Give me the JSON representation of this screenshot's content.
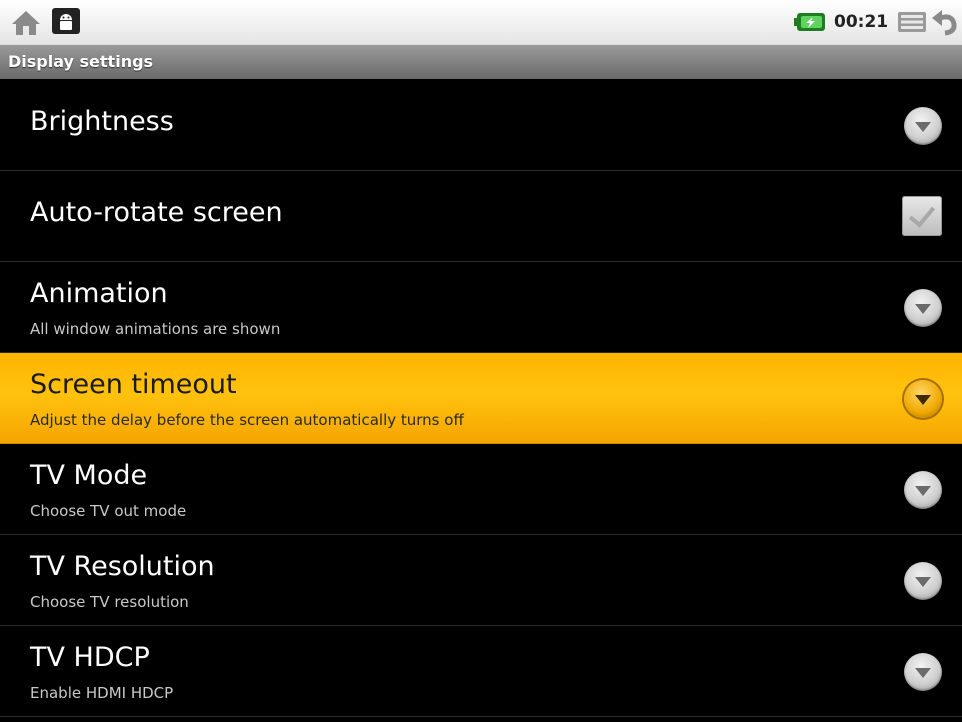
{
  "status_bar": {
    "icons": {
      "left": [
        "home-icon",
        "android-debug-icon"
      ],
      "right": [
        "battery-charging-icon",
        "menu-icon",
        "back-icon"
      ]
    },
    "time": "00:21"
  },
  "title_bar": {
    "title": "Display settings"
  },
  "colors": {
    "highlight": "#ffb400",
    "background": "#000000",
    "title_bar": "#808080"
  },
  "settings": [
    {
      "title": "Brightness",
      "summary": "",
      "control": "dropdown"
    },
    {
      "title": "Auto-rotate screen",
      "summary": "",
      "control": "checkbox",
      "checked": true
    },
    {
      "title": "Animation",
      "summary": "All window animations are shown",
      "control": "dropdown"
    },
    {
      "title": "Screen timeout",
      "summary": "Adjust the delay before the screen automatically turns off",
      "control": "dropdown",
      "highlighted": true
    },
    {
      "title": "TV Mode",
      "summary": "Choose TV out mode",
      "control": "dropdown"
    },
    {
      "title": "TV Resolution",
      "summary": "Choose TV resolution",
      "control": "dropdown"
    },
    {
      "title": "TV HDCP",
      "summary": "Enable HDMI HDCP",
      "control": "dropdown"
    }
  ]
}
